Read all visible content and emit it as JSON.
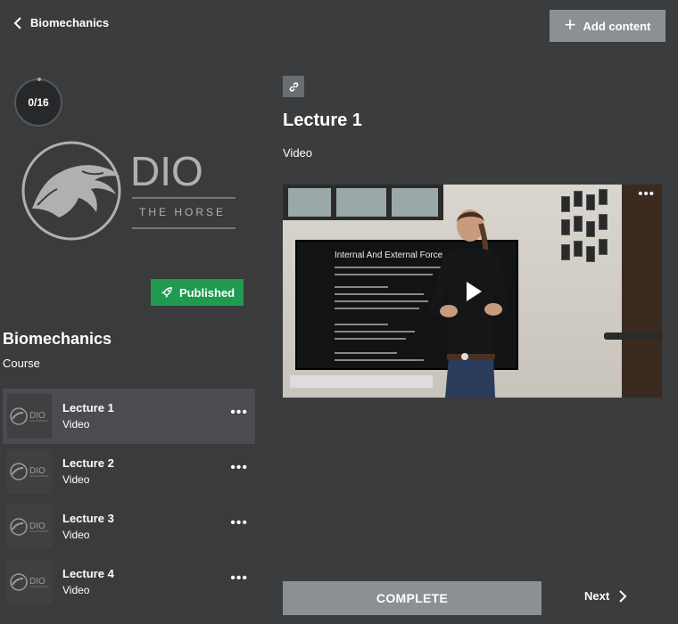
{
  "header": {
    "back_label": "Biomechanics",
    "add_label": "Add content"
  },
  "sidebar": {
    "progress": "0/16",
    "logo": {
      "brand": "DIO",
      "sub": "THE HORSE"
    },
    "status_badge": "Published",
    "course_title": "Biomechanics",
    "course_type": "Course",
    "lectures": [
      {
        "title": "Lecture 1",
        "type": "Video"
      },
      {
        "title": "Lecture 2",
        "type": "Video"
      },
      {
        "title": "Lecture 3",
        "type": "Video"
      },
      {
        "title": "Lecture 4",
        "type": "Video"
      }
    ]
  },
  "main": {
    "title": "Lecture 1",
    "type": "Video",
    "video": {
      "slide_heading": "Internal And External Force"
    },
    "complete_label": "COMPLETE",
    "next_label": "Next"
  },
  "colors": {
    "background": "#3a3c3e",
    "button_gray": "#8d9093",
    "published_green": "#1f9a4f"
  }
}
